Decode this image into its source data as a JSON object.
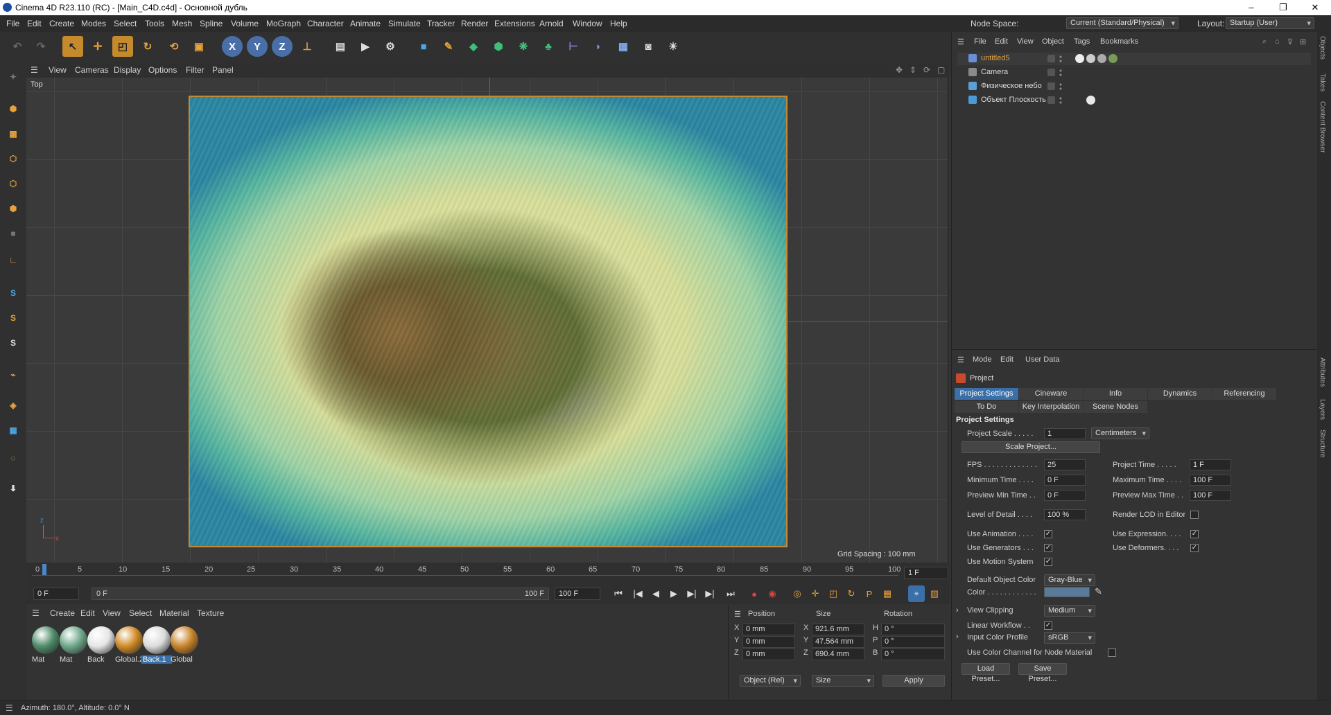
{
  "window": {
    "title": "Cinema 4D R23.110 (RC) - [Main_C4D.c4d] - Основной дубль",
    "min": "–",
    "max": "❐",
    "close": "✕"
  },
  "menu": [
    "File",
    "Edit",
    "Create",
    "Modes",
    "Select",
    "Tools",
    "Mesh",
    "Spline",
    "Volume",
    "MoGraph",
    "Character",
    "Animate",
    "Simulate",
    "Tracker",
    "Render",
    "Extensions",
    "Arnold",
    "Window",
    "Help"
  ],
  "node_space": {
    "label": "Node Space:",
    "value": "Current (Standard/Physical)"
  },
  "layout": {
    "label": "Layout:",
    "value": "Startup (User)"
  },
  "viewport": {
    "menu": [
      "View",
      "Cameras",
      "Display",
      "Options",
      "Filter",
      "Panel"
    ],
    "name": "Top",
    "grid_spacing": "Grid Spacing : 100 mm"
  },
  "timeline": {
    "ticks": [
      "0",
      "5",
      "10",
      "15",
      "20",
      "25",
      "30",
      "35",
      "40",
      "45",
      "50",
      "55",
      "60",
      "65",
      "70",
      "75",
      "80",
      "85",
      "90",
      "95",
      "100"
    ],
    "current": "1 F",
    "start": "0 F",
    "range_start": "0 F",
    "range_end": "100 F",
    "end": "100 F"
  },
  "materials": {
    "menu": [
      "Create",
      "Edit",
      "View",
      "Select",
      "Material",
      "Texture"
    ],
    "items": [
      {
        "name": "Mat",
        "color": "#4f8c6a"
      },
      {
        "name": "Mat",
        "color": "#6fa88a"
      },
      {
        "name": "Back",
        "color": "#e6e6e6"
      },
      {
        "name": "Global.2",
        "color": "#d08a26"
      },
      {
        "name": "Back.1",
        "color": "#dcdcdc"
      },
      {
        "name": "Global",
        "color": "#c9842a"
      }
    ]
  },
  "coords": {
    "headers": [
      "Position",
      "Size",
      "Rotation"
    ],
    "rows": [
      {
        "axis": "X",
        "pos": "0 mm",
        "saxis": "X",
        "size": "921.6 mm",
        "raxis": "H",
        "rot": "0 °"
      },
      {
        "axis": "Y",
        "pos": "0 mm",
        "saxis": "Y",
        "size": "47.564 mm",
        "raxis": "P",
        "rot": "0 °"
      },
      {
        "axis": "Z",
        "pos": "0 mm",
        "saxis": "Z",
        "size": "690.4 mm",
        "raxis": "B",
        "rot": "0 °"
      }
    ],
    "mode": "Object (Rel)",
    "size_mode": "Size",
    "apply": "Apply"
  },
  "status": "Azimuth: 180.0°, Altitude: 0.0°  N",
  "objects": {
    "menu": [
      "File",
      "Edit",
      "View",
      "Object",
      "Tags",
      "Bookmarks"
    ],
    "items": [
      {
        "name": "untitled5",
        "color": "#e6a23c",
        "icon": "#6b8fd6"
      },
      {
        "name": "Camera",
        "color": "#dddddd",
        "icon": "#8a8a8a"
      },
      {
        "name": "Физическое небо",
        "color": "#dddddd",
        "icon": "#5aa0d8"
      },
      {
        "name": "Объект Плоскость",
        "color": "#dddddd",
        "icon": "#4a9ad6"
      }
    ]
  },
  "attributes": {
    "menu": [
      "Mode",
      "Edit",
      "User Data"
    ],
    "title": "Project",
    "tabs": [
      "Project Settings",
      "Cineware",
      "Info",
      "Dynamics",
      "Referencing"
    ],
    "tabs2": [
      "To Do",
      "Key Interpolation",
      "Scene Nodes"
    ],
    "section": "Project Settings",
    "project_scale": {
      "label": "Project Scale . . . . .",
      "value": "1",
      "unit": "Centimeters"
    },
    "scale_button": "Scale Project...",
    "fps": {
      "label": "FPS . . . . . . . . . . . . .",
      "value": "25"
    },
    "project_time": {
      "label": "Project Time . . . . .",
      "value": "1 F"
    },
    "min_time": {
      "label": "Minimum Time . . . .",
      "value": "0 F"
    },
    "max_time": {
      "label": "Maximum Time . . . .",
      "value": "100 F"
    },
    "prev_min": {
      "label": "Preview Min Time . .",
      "value": "0 F"
    },
    "prev_max": {
      "label": "Preview Max Time . .",
      "value": "100 F"
    },
    "lod": {
      "label": "Level of Detail . . . .",
      "value": "100 %"
    },
    "render_lod": "Render LOD in Editor",
    "use_animation": "Use Animation . . . .",
    "use_expression": "Use Expression. . . .",
    "use_generators": "Use Generators . . .",
    "use_deformers": "Use Deformers. . . .",
    "use_motion": "Use Motion System",
    "def_obj_color": {
      "label": "Default Object Color",
      "value": "Gray-Blue"
    },
    "color": {
      "label": "Color . . . . . . . . . . . .",
      "swatch": "#5a7a9a"
    },
    "view_clipping": {
      "label": "View Clipping",
      "value": "Medium"
    },
    "linear_workflow": "Linear Workflow . .",
    "input_profile": {
      "label": "Input Color Profile",
      "value": "sRGB"
    },
    "use_color_channel": "Use Color Channel for Node Material",
    "load_preset": "Load Preset...",
    "save_preset": "Save Preset..."
  },
  "side_tabs": [
    "Objects",
    "Takes",
    "Content Browser",
    "Attributes",
    "Layers",
    "Structure"
  ]
}
